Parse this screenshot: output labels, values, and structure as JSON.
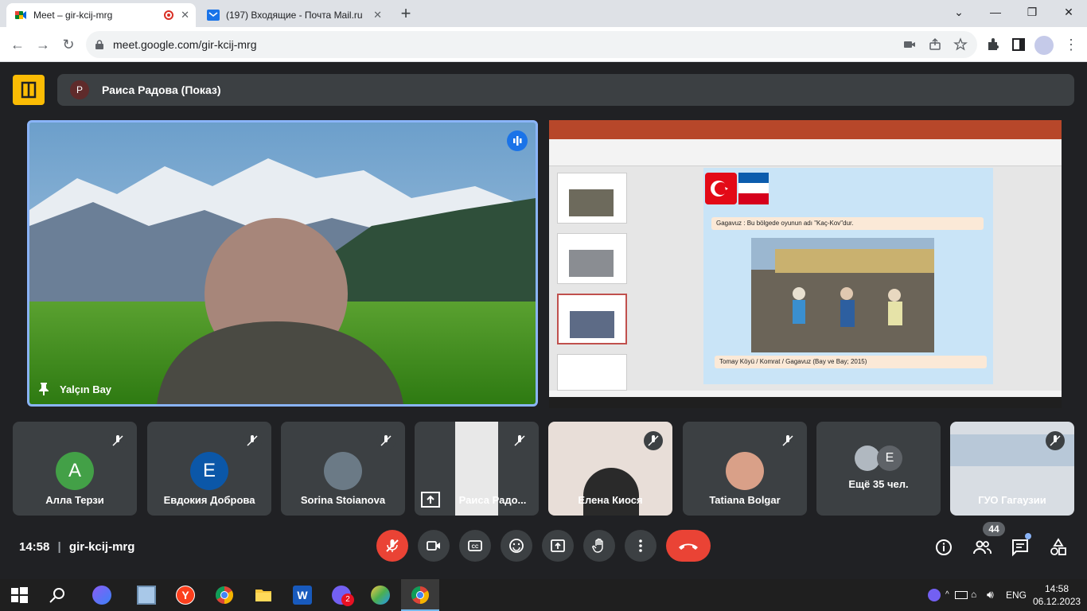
{
  "browser": {
    "tabs": [
      {
        "title": "Meet – gir-kcij-mrg",
        "active": true
      },
      {
        "title": "(197) Входящие - Почта Mail.ru",
        "active": false
      }
    ],
    "url": "meet.google.com/gir-kcij-mrg"
  },
  "meet": {
    "presenter_initial": "Р",
    "presenter_label": "Раиса Радова (Показ)",
    "main_speaker": "Yalçın Bay",
    "slide": {
      "caption": "Gagavuz : Bu bölgede  oyunun adı \"Kaç-Kov\"dur.",
      "photo_caption": "Tomay Köyü / Komrat / Gagavuz (Bay ve Bay; 2015)"
    },
    "participants": [
      {
        "name": "Алла Терзи",
        "initial": "A",
        "color": "#43a047"
      },
      {
        "name": "Евдокия Доброва",
        "initial": "E",
        "color": "#0b57a8"
      },
      {
        "name": "Sorina Stoianova",
        "initial": "",
        "color": "#5f6368"
      },
      {
        "name": "Раиса Радо...",
        "initial": "",
        "color": ""
      },
      {
        "name": "Елена Киося",
        "initial": "",
        "color": ""
      },
      {
        "name": "Tatiana Bolgar",
        "initial": "",
        "color": ""
      },
      {
        "name": "Ещё 35 чел.",
        "initial": "E",
        "color": "#5f6368"
      },
      {
        "name": "ГУО Гагаузии",
        "initial": "",
        "color": ""
      }
    ],
    "time": "14:58",
    "meeting_code": "gir-kcij-mrg",
    "participant_count": "44"
  },
  "taskbar": {
    "lang": "ENG",
    "clock_time": "14:58",
    "clock_date": "06.12.2023",
    "viber_badge": "2"
  }
}
